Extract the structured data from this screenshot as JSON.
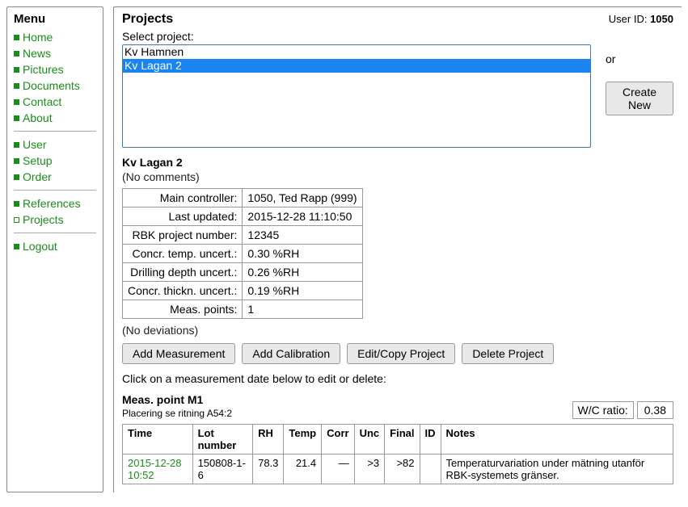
{
  "sidebar": {
    "heading": "Menu",
    "groups": [
      [
        {
          "label": "Home",
          "bullet": "solid"
        },
        {
          "label": "News",
          "bullet": "solid"
        },
        {
          "label": "Pictures",
          "bullet": "solid"
        },
        {
          "label": "Documents",
          "bullet": "solid"
        },
        {
          "label": "Contact",
          "bullet": "solid"
        },
        {
          "label": "About",
          "bullet": "solid"
        }
      ],
      [
        {
          "label": "User",
          "bullet": "solid"
        },
        {
          "label": "Setup",
          "bullet": "solid"
        },
        {
          "label": "Order",
          "bullet": "solid"
        }
      ],
      [
        {
          "label": "References",
          "bullet": "solid"
        },
        {
          "label": "Projects",
          "bullet": "hollow"
        }
      ],
      [
        {
          "label": "Logout",
          "bullet": "solid"
        }
      ]
    ]
  },
  "header": {
    "title": "Projects",
    "user_id_label": "User ID:",
    "user_id": "1050"
  },
  "project_select": {
    "label": "Select project:",
    "options": [
      "Kv Hamnen",
      "Kv Lagan 2"
    ],
    "selected": "Kv Lagan 2",
    "or_label": "or",
    "create_label": "Create New"
  },
  "project": {
    "name": "Kv Lagan 2",
    "comments": "(No comments)",
    "info": [
      {
        "label": "Main controller:",
        "value": "1050, Ted Rapp (999)"
      },
      {
        "label": "Last updated:",
        "value": "2015-12-28 11:10:50"
      },
      {
        "label": "RBK project number:",
        "value": "12345"
      },
      {
        "label": "Concr. temp. uncert.:",
        "value": "0.30 %RH"
      },
      {
        "label": "Drilling depth uncert.:",
        "value": "0.26 %RH"
      },
      {
        "label": "Concr. thickn. uncert.:",
        "value": "0.19 %RH"
      },
      {
        "label": "Meas. points:",
        "value": "1"
      }
    ],
    "deviations": "(No deviations)",
    "buttons": {
      "add_measurement": "Add Measurement",
      "add_calibration": "Add Calibration",
      "edit_copy": "Edit/Copy Project",
      "delete": "Delete Project"
    },
    "hint": "Click on a measurement date below to edit or delete:"
  },
  "meas_point": {
    "title": "Meas. point M1",
    "subtitle": "Placering se ritning A54:2",
    "wc_label": "W/C ratio:",
    "wc_value": "0.38",
    "columns": [
      "Time",
      "Lot number",
      "RH",
      "Temp",
      "Corr",
      "Unc",
      "Final",
      "ID",
      "Notes"
    ],
    "rows": [
      {
        "time": "2015-12-28 10:52",
        "lot": "150808-1-6",
        "rh": "78.3",
        "temp": "21.4",
        "corr": "—",
        "unc": ">3",
        "final": ">82",
        "id": "",
        "notes": "Temperaturvariation under mätning utanför RBK-systemets gränser."
      }
    ]
  }
}
